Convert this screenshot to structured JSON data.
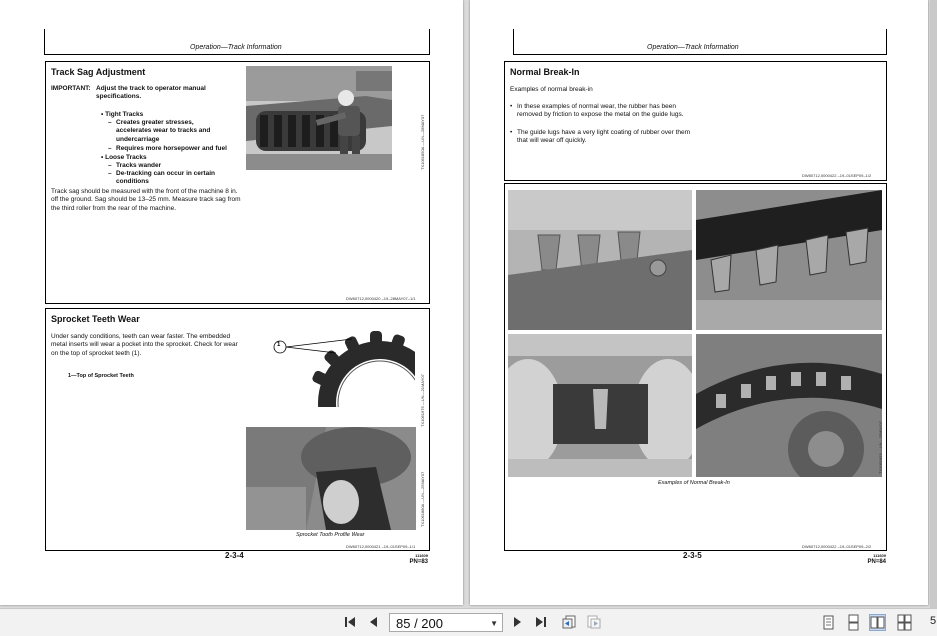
{
  "left_page": {
    "header": "Operation—Track Information",
    "track_sag": {
      "title": "Track Sag Adjustment",
      "important_label": "IMPORTANT:",
      "important_text": "Adjust the track to operator manual specifications.",
      "bullet_tight": "Tight Tracks",
      "tight_items": [
        "Creates greater stresses, accelerates wear to tracks and undercarriage",
        "Requires more horsepower and fuel"
      ],
      "bullet_loose": "Loose Tracks",
      "loose_items": [
        "Tracks wander",
        "De-tracking can occur in certain conditions"
      ],
      "body": "Track sag should be measured with the front of the machine 8 in. off the ground. Sag should be 13–25 mm. Measure track sag from the third roller from the rear of the machine.",
      "photo_code": "TX1061850A —UN—28MAY07",
      "ref_code": "DW80712,0000420 –19–28MAY07–1/1"
    },
    "sprocket": {
      "title": "Sprocket Teeth Wear",
      "body": "Under sandy conditions, teeth can wear faster. The embedded metal inserts will wear a pocket into the sprocket. Check for wear on the top of sprocket teeth (1).",
      "legend": "1—Top of Sprocket Teeth",
      "callout": "1",
      "photo1_code": "TX1061675 —UN—21MAY07",
      "photo2_code": "TX1061880A —UN—25MAY07",
      "caption": "Sprocket Tooth Profile Wear",
      "ref_code": "DW80712,0000421 –19–01SEP09–1/1"
    },
    "page_number": "2-3-4",
    "page_small": "111609",
    "page_small2": "PN=83"
  },
  "right_page": {
    "header": "Operation—Track Information",
    "break_in": {
      "title": "Normal Break-In",
      "intro": "Examples of normal break-in",
      "bullets": [
        "In these examples of normal wear, the rubber has been removed by friction to expose the metal on the guide lugs.",
        "The guide lugs have a very light coating of rubber over them that will wear off quickly."
      ],
      "ref_code": "DW80712,0000422 –19–01SEP09–1/2"
    },
    "photos": {
      "caption": "Examples of Normal Break-In",
      "photo_code": "TX1061853 —UN—25MAY07",
      "ref_code": "DW80712,0000422 –19–01SEP09–2/2"
    },
    "page_number": "2-3-5",
    "page_small": "111609",
    "page_small2": "PN=84"
  },
  "toolbar": {
    "page_value": "85 / 200",
    "icons": [
      "first-page-icon",
      "prev-page-icon",
      "next-page-icon",
      "last-page-icon",
      "go-back-icon",
      "go-forward-icon",
      "single-page-view-icon",
      "continuous-view-icon",
      "two-page-view-icon",
      "two-page-continuous-view-icon"
    ],
    "edge_char": "5"
  },
  "colors": {
    "accent": "#c7d9ef",
    "toolbar_bg": "#f2f2f2",
    "viewer_bg": "#dadada"
  }
}
